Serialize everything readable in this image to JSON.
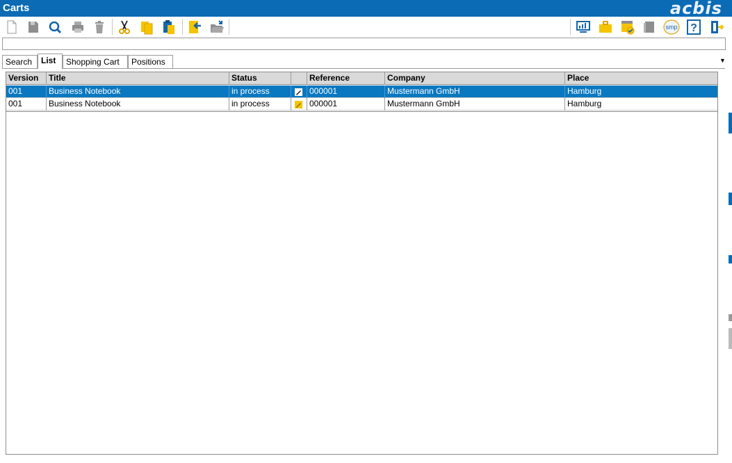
{
  "window": {
    "title": "Carts",
    "brand": "acbis"
  },
  "toolbar": {
    "left_icons": [
      "new-document-icon",
      "save-icon",
      "search-icon",
      "print-icon",
      "delete-icon",
      "cut-icon",
      "copy-icon",
      "paste-icon",
      "import-icon",
      "open-folder-icon"
    ],
    "right_icons": [
      "monitor-chart-icon",
      "briefcase-icon",
      "approve-card-icon",
      "book-icon",
      "smp-icon",
      "help-icon",
      "exit-icon"
    ],
    "smp_label": "smp",
    "help_label": "?"
  },
  "command_bar": {
    "value": ""
  },
  "tabs": [
    {
      "label": "Search",
      "active": false
    },
    {
      "label": "List",
      "active": true
    },
    {
      "label": "Shopping Cart",
      "active": false
    },
    {
      "label": "Positions",
      "active": false
    }
  ],
  "grid": {
    "columns": [
      "Version",
      "Title",
      "Status",
      "",
      "Reference",
      "Company",
      "Place"
    ],
    "rows": [
      {
        "version": "001",
        "title": "Business Notebook",
        "status": "in process",
        "status_icon": "edit-status-icon",
        "reference": "000001",
        "company": "Mustermann GmbH",
        "place": "Hamburg",
        "selected": true
      },
      {
        "version": "001",
        "title": "Business Notebook",
        "status": "in process",
        "status_icon": "edit-status-icon",
        "reference": "000001",
        "company": "Mustermann GmbH",
        "place": "Hamburg",
        "selected": false
      }
    ]
  },
  "colors": {
    "titlebar": "#0b6bb5",
    "selected_row": "#0a78c0",
    "header_bg": "#d9d9d9",
    "icon_yellow": "#f5c400",
    "icon_blue": "#1565a8"
  }
}
